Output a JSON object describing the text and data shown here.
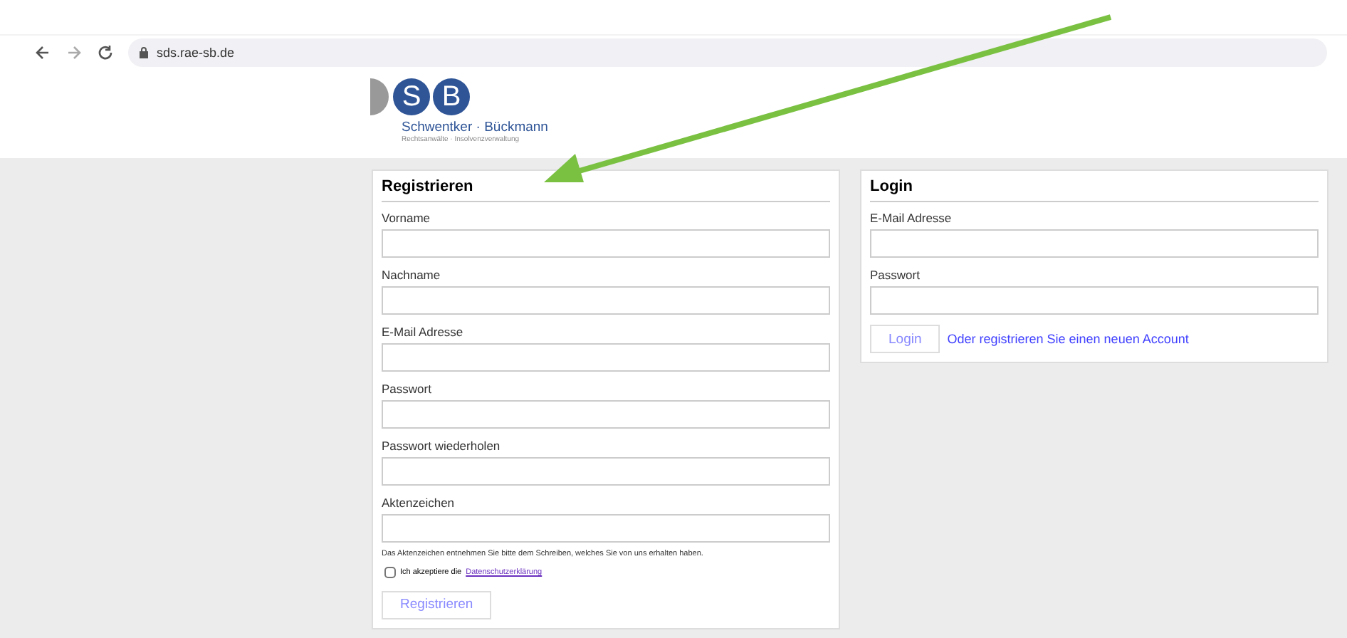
{
  "browser": {
    "url": "sds.rae-sb.de"
  },
  "logo": {
    "letters": [
      "S",
      "B"
    ],
    "name": "Schwentker · Bückmann",
    "tagline": "Rechtsanwälte · Insolvenzverwaltung"
  },
  "register": {
    "title": "Registrieren",
    "fields": [
      {
        "label": "Vorname"
      },
      {
        "label": "Nachname"
      },
      {
        "label": "E-Mail Adresse"
      },
      {
        "label": "Passwort"
      },
      {
        "label": "Passwort wiederholen"
      },
      {
        "label": "Aktenzeichen"
      }
    ],
    "note": "Das Aktenzeichen entnehmen Sie bitte dem Schreiben, welches Sie von uns erhalten haben.",
    "consent": {
      "text": "Ich akzeptiere die",
      "link": "Datenschutzerklärung",
      "checked": false
    },
    "button": "Registrieren"
  },
  "login": {
    "title": "Login",
    "fields": [
      {
        "label": "E-Mail Adresse"
      },
      {
        "label": "Passwort"
      }
    ],
    "button": "Login",
    "link": "Oder registrieren Sie einen neuen Account"
  }
}
